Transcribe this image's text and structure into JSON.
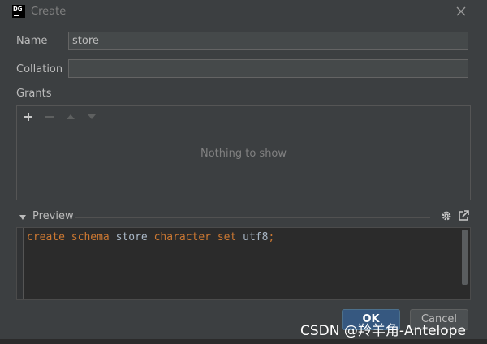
{
  "window": {
    "app_logo_text": "DG",
    "title": "Create"
  },
  "form": {
    "name_label": "Name",
    "name_value": "store",
    "collation_label": "Collation",
    "collation_value": "",
    "grants_label": "Grants"
  },
  "grants": {
    "empty_text": "Nothing to show",
    "toolbar_icons": [
      "add-icon",
      "remove-icon",
      "move-up-icon",
      "move-down-icon"
    ]
  },
  "preview": {
    "label": "Preview",
    "code_tokens": [
      {
        "text": "create ",
        "kind": "keyword"
      },
      {
        "text": "schema ",
        "kind": "keyword"
      },
      {
        "text": "store ",
        "kind": "identifier"
      },
      {
        "text": "character ",
        "kind": "keyword"
      },
      {
        "text": "set ",
        "kind": "keyword"
      },
      {
        "text": "utf8",
        "kind": "identifier"
      },
      {
        "text": ";",
        "kind": "keyword"
      }
    ]
  },
  "buttons": {
    "ok_label": "OK",
    "cancel_label": "Cancel"
  },
  "watermark": "CSDN @羚羊角-Antelope",
  "colors": {
    "background": "#3c3f41",
    "editor_bg": "#2b2b2b",
    "keyword": "#cc7832",
    "identifier": "#a9b7c6",
    "ok_button": "#365880"
  }
}
